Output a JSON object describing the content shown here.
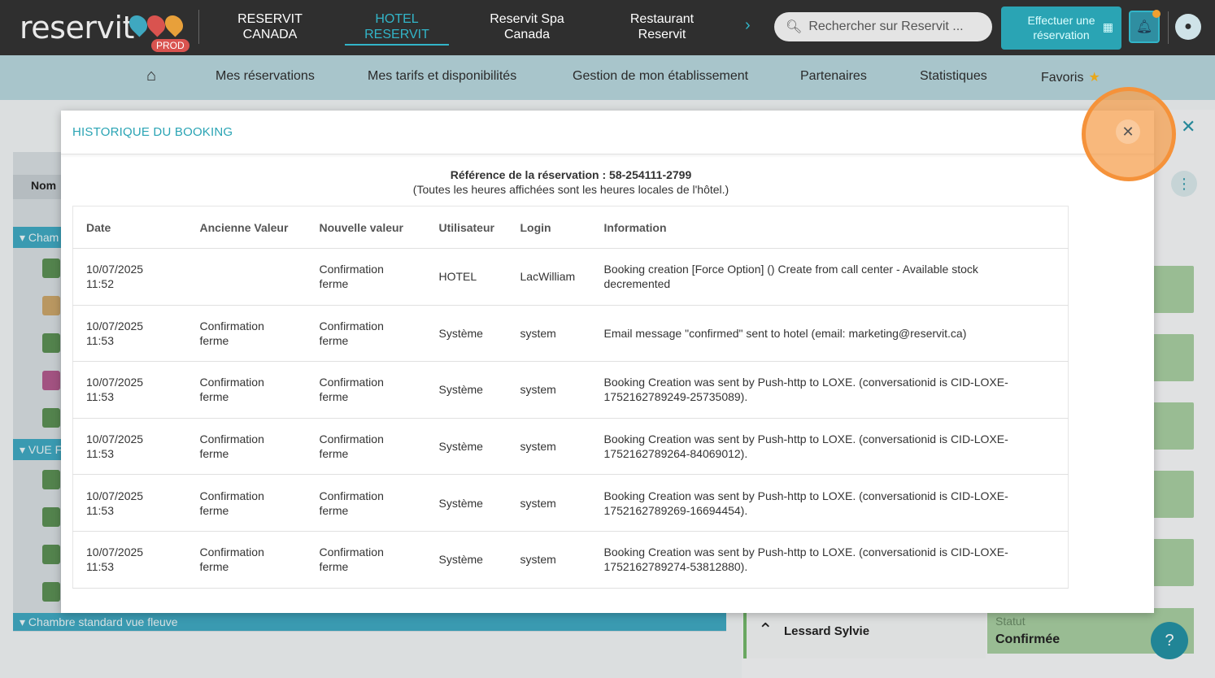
{
  "topbar": {
    "logo": "reservit",
    "badge": "PROD",
    "tabs": [
      {
        "label_line1": "RESERVIT",
        "label_line2": "CANADA",
        "active": false
      },
      {
        "label_line1": "HOTEL",
        "label_line2": "RESERVIT",
        "active": true
      },
      {
        "label_line1": "Reservit Spa",
        "label_line2": "Canada",
        "active": false
      },
      {
        "label_line1": "Restaurant",
        "label_line2": "Reservit",
        "active": false
      }
    ],
    "search_placeholder": "Rechercher sur Reservit ...",
    "book_button_line1": "Effectuer une",
    "book_button_line2": "réservation"
  },
  "subnav": {
    "items": [
      "Mes réservations",
      "Mes tarifs et disponibilités",
      "Gestion de mon établissement",
      "Partenaires",
      "Statistiques",
      "Favoris"
    ]
  },
  "background": {
    "column_nom": "Nom",
    "group1": "Cham",
    "group2": "VUE F",
    "group3": "Chambre standard vue fleuve",
    "person_name": "Lessard Sylvie",
    "status_label": "Statut",
    "status_value": "Confirmée",
    "help": "?"
  },
  "modal": {
    "title": "HISTORIQUE DU BOOKING",
    "reference": "Référence de la réservation : 58-254111-2799",
    "note": "(Toutes les heures affichées sont les heures locales de l'hôtel.)",
    "columns": [
      "Date",
      "Ancienne Valeur",
      "Nouvelle valeur",
      "Utilisateur",
      "Login",
      "Information"
    ],
    "rows": [
      {
        "date": "10/07/2025",
        "time": "11:52",
        "old1": "",
        "old2": "",
        "new1": "Confirmation",
        "new2": "ferme",
        "user": "HOTEL",
        "login": "LacWilliam",
        "info1": "Booking creation [Force Option] () Create from call center - Available stock",
        "info2": "decremented"
      },
      {
        "date": "10/07/2025",
        "time": "11:53",
        "old1": "Confirmation",
        "old2": "ferme",
        "new1": "Confirmation",
        "new2": "ferme",
        "user": "Système",
        "login": "system",
        "info1": "Email message \"confirmed\" sent to hotel (email: marketing@reservit.ca)",
        "info2": ""
      },
      {
        "date": "10/07/2025",
        "time": "11:53",
        "old1": "Confirmation",
        "old2": "ferme",
        "new1": "Confirmation",
        "new2": "ferme",
        "user": "Système",
        "login": "system",
        "info1": "Booking Creation was sent by Push-http to LOXE. (conversationid is CID-LOXE-",
        "info2": "1752162789249-25735089)."
      },
      {
        "date": "10/07/2025",
        "time": "11:53",
        "old1": "Confirmation",
        "old2": "ferme",
        "new1": "Confirmation",
        "new2": "ferme",
        "user": "Système",
        "login": "system",
        "info1": "Booking Creation was sent by Push-http to LOXE. (conversationid is CID-LOXE-",
        "info2": "1752162789264-84069012)."
      },
      {
        "date": "10/07/2025",
        "time": "11:53",
        "old1": "Confirmation",
        "old2": "ferme",
        "new1": "Confirmation",
        "new2": "ferme",
        "user": "Système",
        "login": "system",
        "info1": "Booking Creation was sent by Push-http to LOXE. (conversationid is CID-LOXE-",
        "info2": "1752162789269-16694454)."
      },
      {
        "date": "10/07/2025",
        "time": "11:53",
        "old1": "Confirmation",
        "old2": "ferme",
        "new1": "Confirmation",
        "new2": "ferme",
        "user": "Système",
        "login": "system",
        "info1": "Booking Creation was sent by Push-http to LOXE. (conversationid is CID-LOXE-",
        "info2": "1752162789274-53812880)."
      }
    ]
  },
  "colors": {
    "accent": "#2aa4b4",
    "highlight": "#f5923a"
  }
}
